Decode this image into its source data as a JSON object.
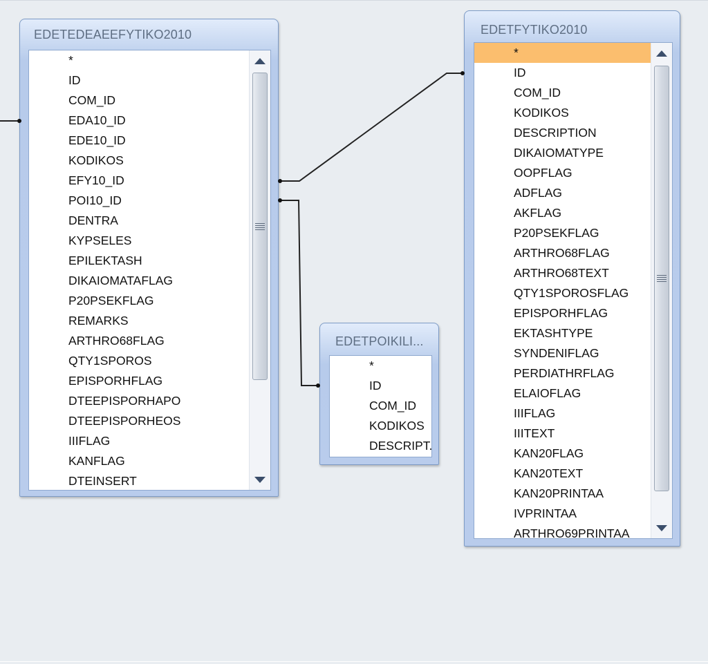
{
  "tables": {
    "left": {
      "title": "EDETEDEAEEFYTIKO2010",
      "fields": [
        "*",
        "ID",
        "COM_ID",
        "EDA10_ID",
        "EDE10_ID",
        "KODIKOS",
        "EFY10_ID",
        "POI10_ID",
        "DENTRA",
        "KYPSELES",
        "EPILEKTASH",
        "DIKAIOMATAFLAG",
        "P20PSEKFLAG",
        "REMARKS",
        "ARTHRO68FLAG",
        "QTY1SPOROS",
        "EPISPORHFLAG",
        "DTEEPISPORHAPO",
        "DTEEPISPORHEOS",
        "IIIFLAG",
        "KANFLAG",
        "DTEINSERT"
      ]
    },
    "middle": {
      "title": "EDETPOIKILI...",
      "fields": [
        "*",
        "ID",
        "COM_ID",
        "KODIKOS",
        "DESCRIPT..."
      ]
    },
    "right": {
      "title": "EDETFYTIKO2010",
      "fields": [
        "*",
        "ID",
        "COM_ID",
        "KODIKOS",
        "DESCRIPTION",
        "DIKAIOMATYPE",
        "OOPFLAG",
        "ADFLAG",
        "AKFLAG",
        "P20PSEKFLAG",
        "ARTHRO68FLAG",
        "ARTHRO68TEXT",
        "QTY1SPOROSFLAG",
        "EPISPORHFLAG",
        "EKTASHTYPE",
        "SYNDENIFLAG",
        "PERDIATHRFLAG",
        "ELAIOFLAG",
        "IIIFLAG",
        "IIITEXT",
        "KAN20FLAG",
        "KAN20TEXT",
        "KAN20PRINTAA",
        "IVPRINTAA",
        "ARTHRO69PRINTAA"
      ],
      "selected_field": "*"
    }
  },
  "colors": {
    "canvas": "#e9edf1",
    "selection": "#fbbe6e",
    "title_text": "#5e6e83",
    "relationship_line": "#222222"
  }
}
